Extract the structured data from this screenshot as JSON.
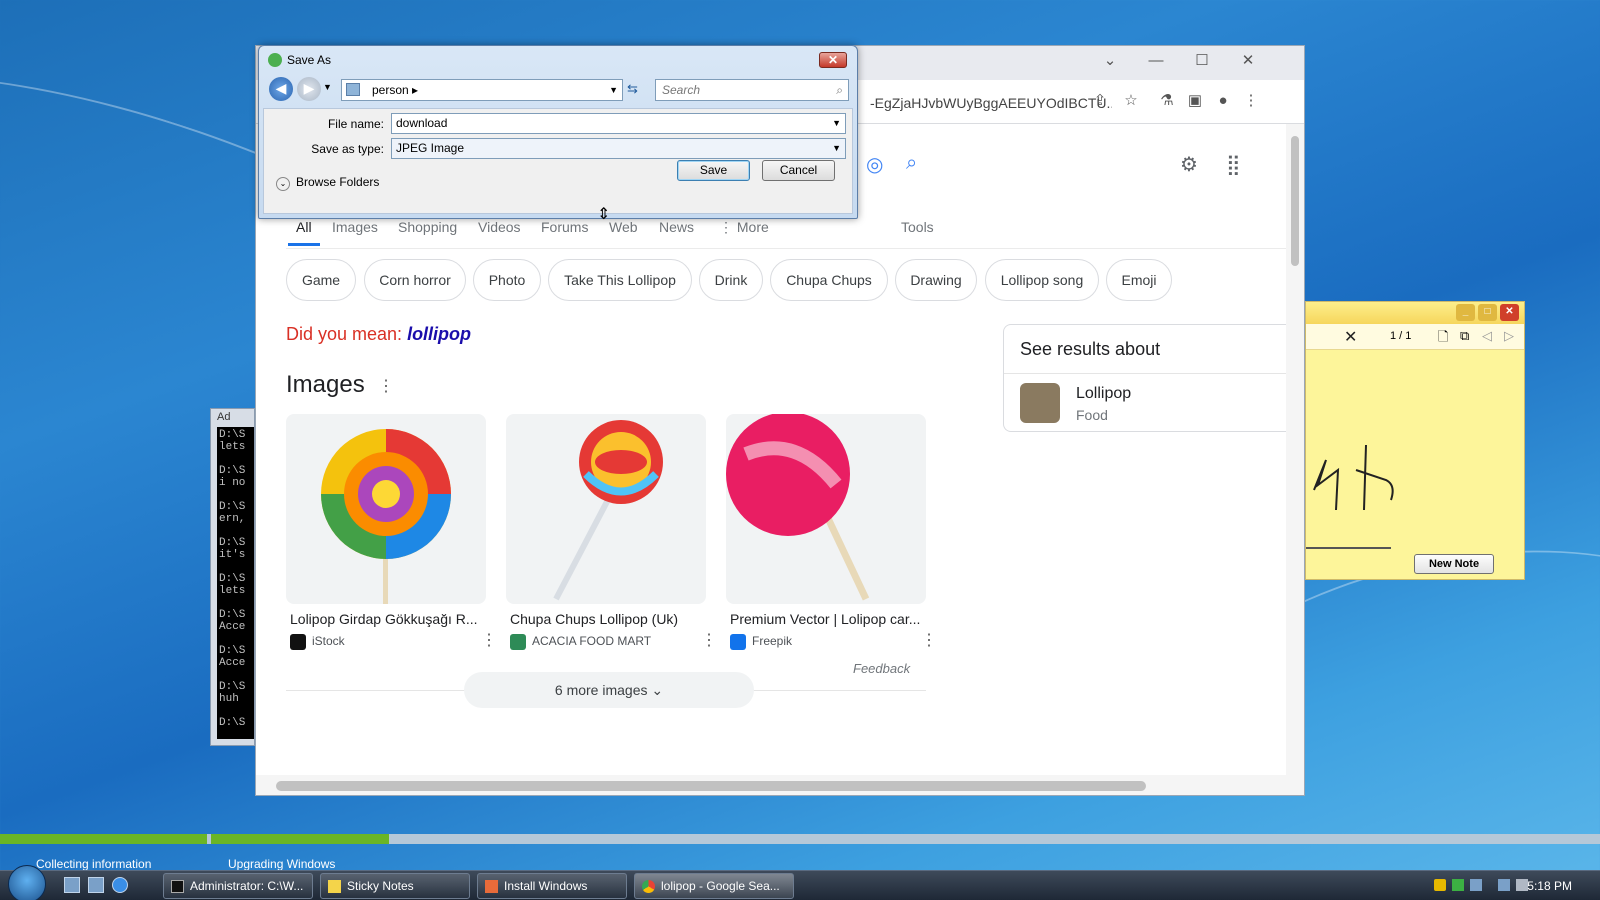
{
  "cmd": {
    "title": "Ad",
    "lines": "D:\\S\nlets\n\nD:\\S\ni no\n\nD:\\S\nern,\n\nD:\\S\nit's\n\nD:\\S\nlets\n\nD:\\S\nAcce\n\nD:\\S\nAcce\n\nD:\\S\nhuh\n\nD:\\S"
  },
  "browser": {
    "url": "-EgZjaHJvbWUyBggAEEUYOdIBCTU...",
    "tabs": [
      "All",
      "Images",
      "Shopping",
      "Videos",
      "Forums",
      "Web",
      "News",
      "⋮ More"
    ],
    "tools": "Tools",
    "chips": [
      "Game",
      "Corn horror",
      "Photo",
      "Take This Lollipop",
      "Drink",
      "Chupa Chups",
      "Drawing",
      "Lollipop song",
      "Emoji"
    ],
    "did_you_mean_prefix": "Did you mean: ",
    "did_you_mean_term": "lollipop",
    "images_heading": "Images",
    "images": [
      {
        "caption": "Lolipop Girdap Gökkuşağı R...",
        "source": "iStock"
      },
      {
        "caption": "Chupa Chups Lollipop (Uk)",
        "source": "ACACIA FOOD MART"
      },
      {
        "caption": "Premium Vector | Lolipop car...",
        "source": "Freepik"
      }
    ],
    "feedback": "Feedback",
    "more_images": "6 more images",
    "knowledge": {
      "heading": "See results about",
      "name": "Lollipop",
      "type": "Food"
    }
  },
  "dialog": {
    "title": "Save As",
    "path": "person",
    "search_placeholder": "Search",
    "file_name_label": "File name:",
    "file_name_value": "download",
    "save_type_label": "Save as type:",
    "save_type_value": "JPEG Image",
    "browse_folders": "Browse Folders",
    "save": "Save",
    "cancel": "Cancel"
  },
  "sticky": {
    "page": "1 / 1",
    "new_note": "New Note"
  },
  "progress": {
    "label1": "Collecting information",
    "label2": "Upgrading Windows"
  },
  "taskbar": {
    "items": [
      {
        "label": "Administrator: C:\\W..."
      },
      {
        "label": "Sticky Notes"
      },
      {
        "label": "Install Windows"
      },
      {
        "label": "lolipop - Google Sea..."
      }
    ],
    "clock": "5:18 PM"
  },
  "colors": {
    "accent": "#1a73e8",
    "did_you_mean": "#d93025",
    "link": "#1a0dab"
  }
}
